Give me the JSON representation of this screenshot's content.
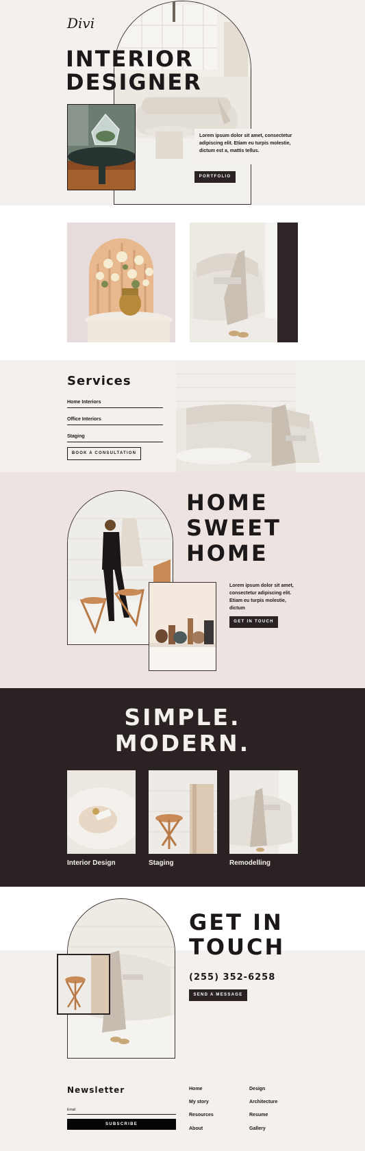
{
  "hero": {
    "logo": "Divi",
    "title_line1": "INTERIOR",
    "title_line2": "DESIGNER",
    "body": "Lorem ipsum dolor sit amet, consectetur adipiscing elit. Etiam eu turpis molestie, dictum est a, mattis tellus.",
    "button": "PORTFOLIO"
  },
  "services": {
    "heading": "Services",
    "items": [
      "Home Interiors",
      "Office Interiors",
      "Staging"
    ],
    "button": "BOOK A CONSULTATION"
  },
  "home": {
    "line1": "HOME",
    "line2": "SWEET",
    "line3": "HOME",
    "body": "Lorem ipsum dolor sit amet, consectetur adipiscing elit. Etiam eu turpis molestie, dictum",
    "button": "GET IN TOUCH"
  },
  "simple": {
    "line1": "SIMPLE.",
    "line2": "MODERN.",
    "cards": [
      {
        "label": "Interior Design"
      },
      {
        "label": "Staging"
      },
      {
        "label": "Remodelling"
      }
    ]
  },
  "contact": {
    "line1": "GET IN",
    "line2": "TOUCH",
    "phone": "(255) 352-6258",
    "button": "SEND A MESSAGE"
  },
  "footer": {
    "newsletter_heading": "Newsletter",
    "email_label": "Email",
    "subscribe": "SUBSCRIBE",
    "links_col1": [
      "Home",
      "My story",
      "Resources",
      "About"
    ],
    "links_col2": [
      "Design",
      "Architecture",
      "Resume",
      "Gallery"
    ]
  },
  "colors": {
    "cream": "#f4f0ed",
    "blush": "#ede4e1",
    "dark": "#2b2323",
    "text": "#1c1718"
  }
}
